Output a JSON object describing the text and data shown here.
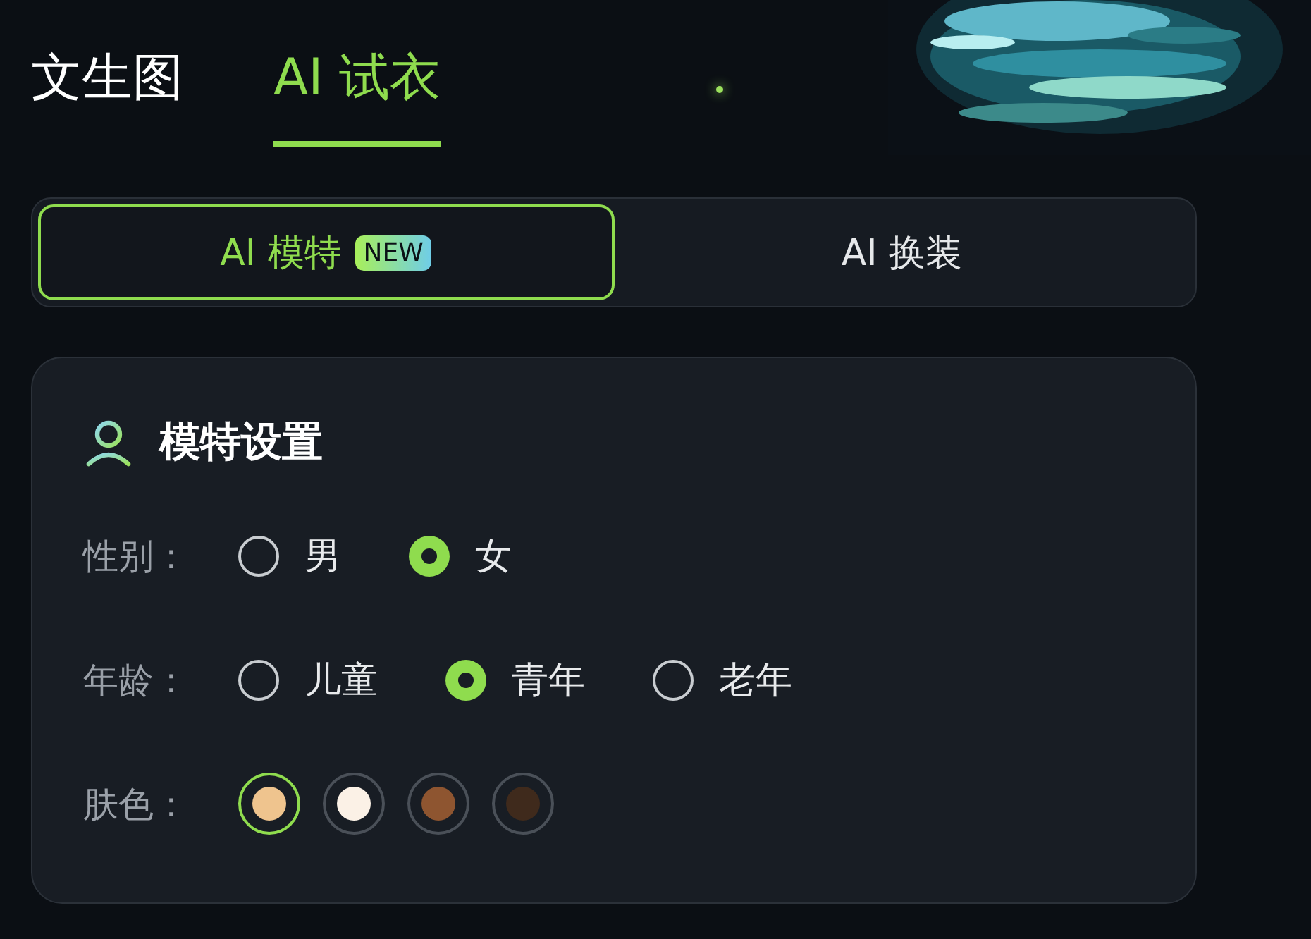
{
  "tabs": [
    {
      "label": "文生图",
      "selected": false
    },
    {
      "label": "AI 试衣",
      "selected": true
    }
  ],
  "modes": [
    {
      "label": "AI 模特",
      "badge": "NEW",
      "selected": true
    },
    {
      "label": "AI 换装",
      "selected": false
    }
  ],
  "model_settings": {
    "title": "模特设置",
    "rows": [
      {
        "kind": "radio",
        "label": "性别：",
        "options": [
          {
            "label": "男",
            "selected": false
          },
          {
            "label": "女",
            "selected": true
          }
        ]
      },
      {
        "kind": "radio",
        "label": "年龄：",
        "options": [
          {
            "label": "儿童",
            "selected": false
          },
          {
            "label": "青年",
            "selected": true
          },
          {
            "label": "老年",
            "selected": false
          }
        ]
      },
      {
        "kind": "swatch",
        "label": "肤色：",
        "options": [
          {
            "color": "#efc48e",
            "selected": true
          },
          {
            "color": "#fbf1e6",
            "selected": false
          },
          {
            "color": "#8e5530",
            "selected": false
          },
          {
            "color": "#3f2a1c",
            "selected": false
          }
        ]
      }
    ]
  }
}
